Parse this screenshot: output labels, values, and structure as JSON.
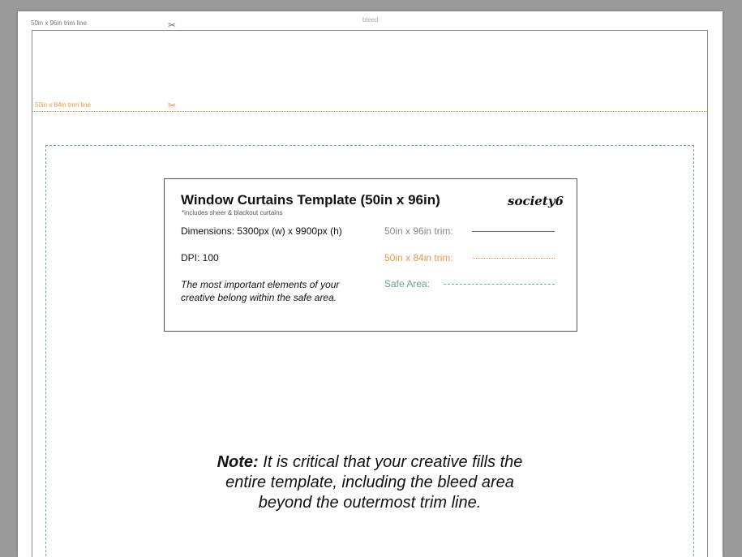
{
  "labels": {
    "trim96": "50in x 96in trim line",
    "bleed": "bleed",
    "trim84": "50in x 84in trim line"
  },
  "info": {
    "title": "Window Curtains Template (50in x 96in)",
    "subtitle": "*includes sheer & blackout curtains",
    "logo": "society6",
    "dimensions": "Dimensions: 5300px (w) x 9900px (h)",
    "dpi": "DPI: 100",
    "note": "The most important elements of your creative belong within the safe area.",
    "legend_trim96": "50in x 96in trim:",
    "legend_trim84": "50in x 84in trim:",
    "legend_safe": "Safe Area:"
  },
  "note": {
    "prefix": "Note:",
    "text": " It is critical that your creative fills the entire template, including the bleed area beyond the outermost trim line."
  },
  "colors": {
    "trim96": "#8a8a8a",
    "trim84": "#e39a48",
    "safe": "#6fa48c",
    "background": "#9a9a9a"
  },
  "icons": {
    "scissors": "scissors-icon"
  }
}
